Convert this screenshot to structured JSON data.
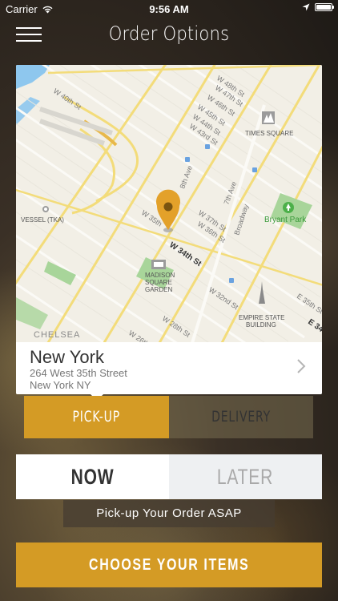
{
  "status_bar": {
    "carrier": "Carrier",
    "time": "9:56 AM"
  },
  "header": {
    "title": "Order Options"
  },
  "map": {
    "labels": {
      "w48": "W 48th St",
      "w47": "W 47th St",
      "w46": "W 46th St",
      "w45": "W 45th St",
      "w44": "W 44th St",
      "w43": "W 43rd St",
      "w40": "W 40th St",
      "times_square": "TIMES SQUARE",
      "eighth_ave": "8th Ave",
      "seventh_ave": "7th Ave",
      "broadway": "Broadway",
      "vessel": "VESSEL (TKA)",
      "bryant_park": "Bryant Park",
      "w35": "W 35th",
      "w37": "W 37th St",
      "w36": "W 36th St",
      "w34": "W 34th St",
      "msg_line1": "MADISON",
      "msg_line2": "SQUARE",
      "msg_line3": "GARDEN",
      "w32": "W 32nd St",
      "e35": "E 35th St",
      "esb_line1": "EMPIRE STATE",
      "esb_line2": "BUILDING",
      "w28": "W 28th St",
      "chelsea": "CHELSEA",
      "w26": "W 26th St",
      "e34": "E 34"
    }
  },
  "location": {
    "name": "New York",
    "address_line1": "264 West 35th Street",
    "address_line2": "New York NY"
  },
  "order_type": {
    "pickup_label": "PICK-UP",
    "delivery_label": "DELIVERY",
    "selected": "PICK-UP"
  },
  "timing": {
    "now_label": "NOW",
    "later_label": "LATER",
    "selected": "NOW"
  },
  "pickup_note": "Pick-up Your Order ASAP",
  "choose_button": "CHOOSE YOUR ITEMS",
  "colors": {
    "accent": "#d49b25",
    "map_pin": "#e3a12a",
    "park_green": "#a8d59a"
  }
}
